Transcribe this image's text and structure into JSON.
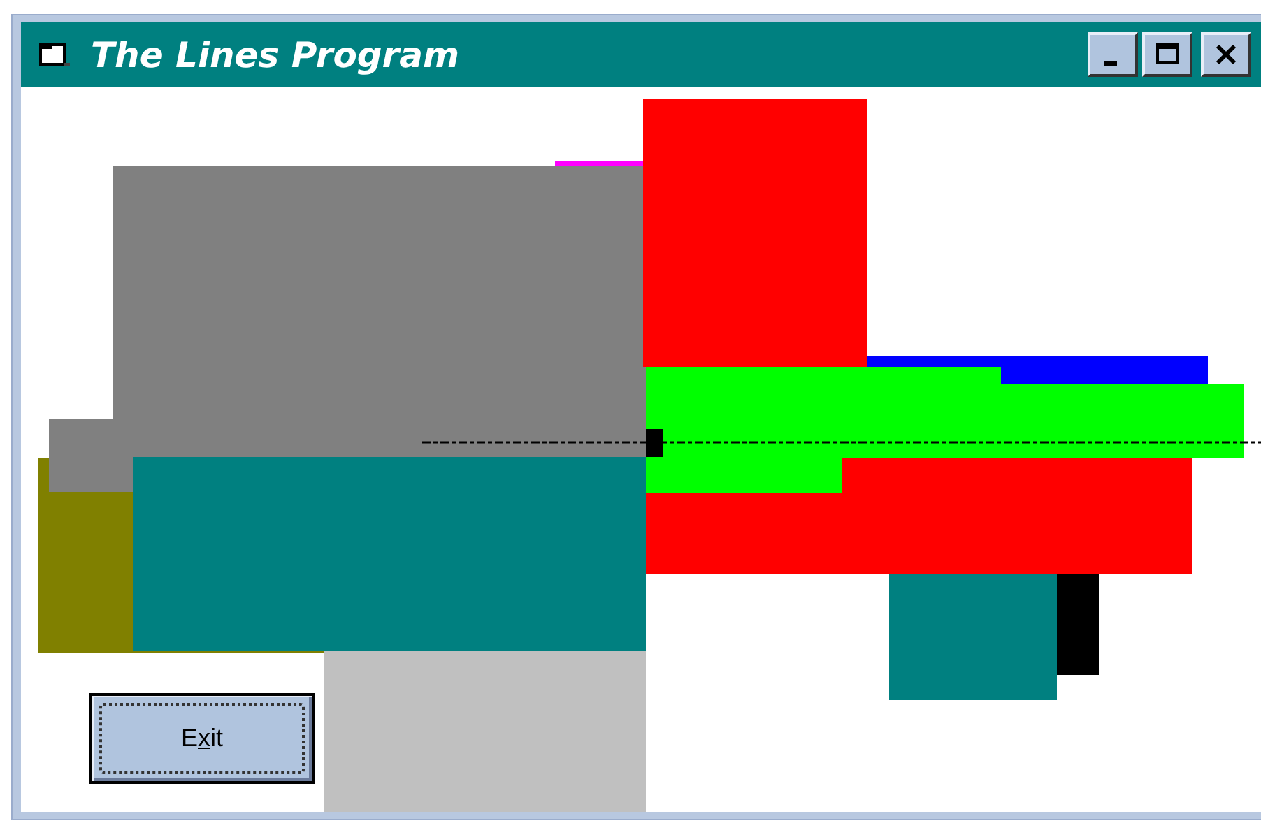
{
  "window": {
    "title": "The Lines Program"
  },
  "title_buttons": [
    {
      "kind": "minimize"
    },
    {
      "kind": "maximize"
    },
    {
      "kind": "close"
    }
  ],
  "exit_button": {
    "label_before": "E",
    "access_key": "x",
    "label_after": "it",
    "focused": true
  }
}
